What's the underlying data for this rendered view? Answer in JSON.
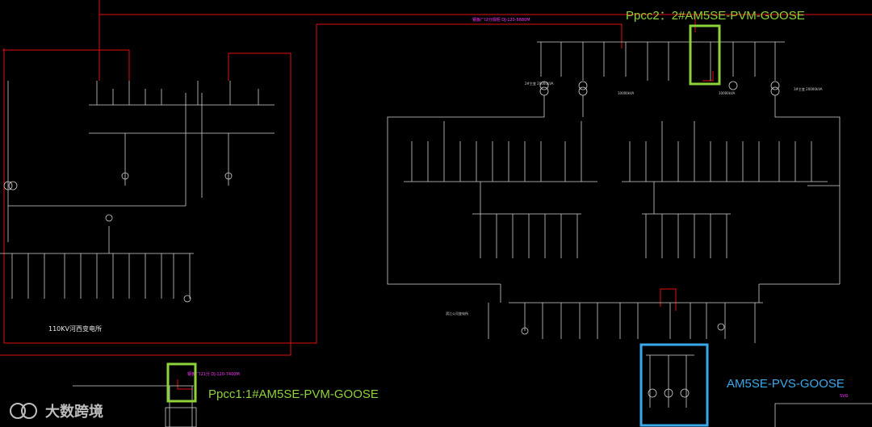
{
  "annotations": {
    "ppcc1": "Ppcc1:1#AM5SE-PVM-GOOSE",
    "ppcc2": "Ppcc2：2#AM5SE-PVM-GOOSE",
    "pvs": "AM5SE-PVS-GOOSE"
  },
  "labels": {
    "substation_left": "110KV河西变电所",
    "substation_mid": "滨江公司变电所",
    "line_label_top": "钢板厂I2分馈柜  DJ-120-5680M",
    "line_label_bottom": "钢板厂I21分  DJ-120-7400M",
    "transformer_1": "3#主变 20000kVA",
    "transformer_2": "2#主变 20000kVA",
    "cap_1": "10000kVA",
    "cap_2": "10000kVA",
    "station_svg": "SVG"
  },
  "watermark": {
    "logo": "ꝇ",
    "text": "大数跨境"
  },
  "colors": {
    "background": "#000000",
    "wiring": "#cfcfcf",
    "bus_red": "#e01010",
    "highlight_green": "#8ed23b",
    "highlight_blue": "#3aa9ea",
    "text_magenta": "#ff33ff"
  }
}
